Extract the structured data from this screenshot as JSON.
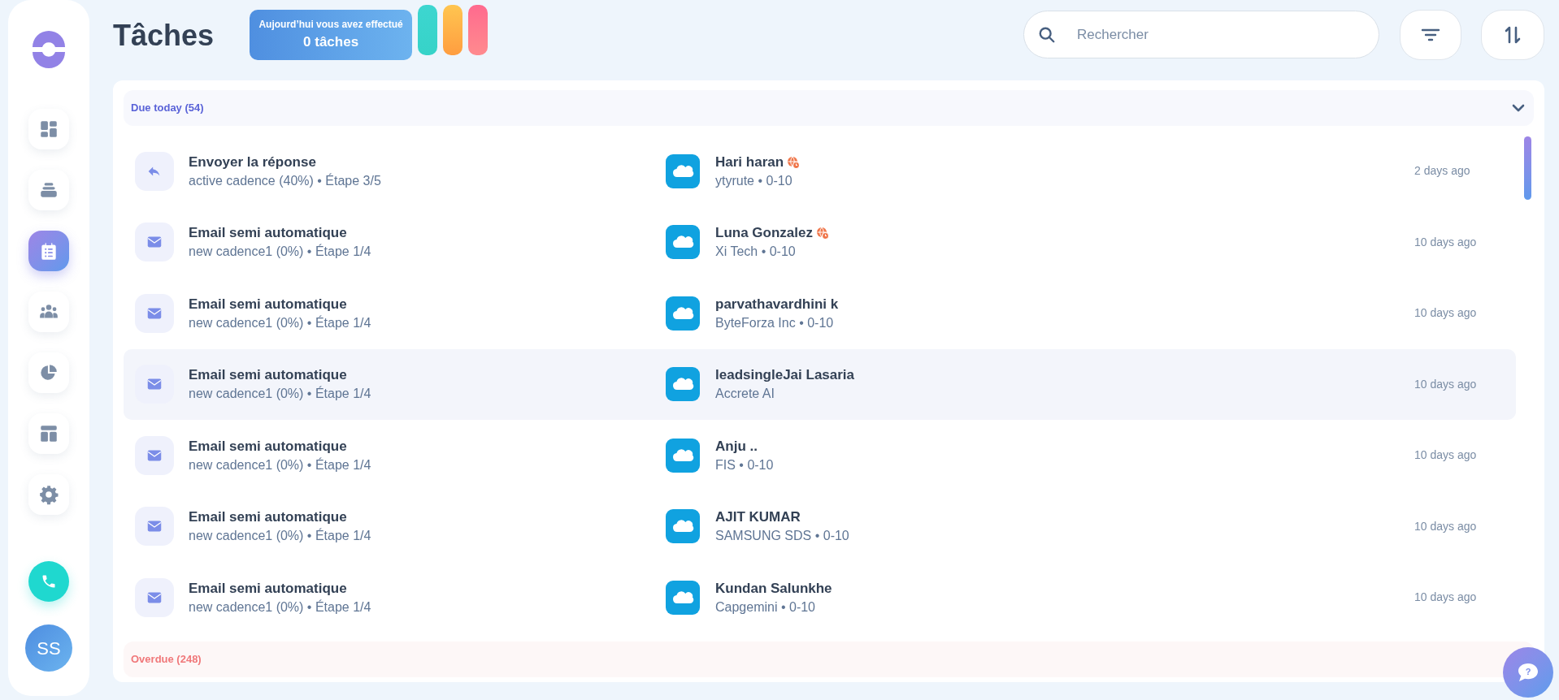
{
  "page": {
    "title": "Tâches"
  },
  "summary": {
    "caption": "Aujourd’hui vous avez effectué",
    "count": "0 tâches"
  },
  "sidebar": {
    "items": [
      {
        "kind": "dashboard",
        "selected": false
      },
      {
        "kind": "inbox",
        "selected": false
      },
      {
        "kind": "tasks",
        "selected": true
      },
      {
        "kind": "people",
        "selected": false
      },
      {
        "kind": "chart",
        "selected": false
      },
      {
        "kind": "layout",
        "selected": false
      },
      {
        "kind": "settings",
        "selected": false
      }
    ],
    "avatar": "SS"
  },
  "search": {
    "placeholder": "Rechercher"
  },
  "groups": [
    {
      "kind": "today",
      "label": "Due today (54)",
      "expanded": true,
      "rows": [
        {
          "kind": "reply",
          "title": "Envoyer la réponse",
          "subtitle": "active cadence (40%) • Étape 3/5",
          "contact": "Hari haran",
          "timezone_alert": true,
          "company": "ytyrute • 0-10",
          "time": "2 days ago",
          "selected": false
        },
        {
          "kind": "email",
          "title": "Email semi automatique",
          "subtitle": "new cadence1 (0%) • Étape 1/4",
          "contact": "Luna Gonzalez",
          "timezone_alert": true,
          "company": "Xi Tech • 0-10",
          "time": "10 days ago",
          "selected": false
        },
        {
          "kind": "email",
          "title": "Email semi automatique",
          "subtitle": "new cadence1 (0%) • Étape 1/4",
          "contact": "parvathavardhini k",
          "timezone_alert": false,
          "company": "ByteForza Inc • 0-10",
          "time": "10 days ago",
          "selected": false
        },
        {
          "kind": "email",
          "title": "Email semi automatique",
          "subtitle": "new cadence1 (0%) • Étape 1/4",
          "contact": "leadsingleJai Lasaria",
          "timezone_alert": false,
          "company": "Accrete AI",
          "time": "10 days ago",
          "selected": true
        },
        {
          "kind": "email",
          "title": "Email semi automatique",
          "subtitle": "new cadence1 (0%) • Étape 1/4",
          "contact": "Anju ..",
          "timezone_alert": false,
          "company": "FIS • 0-10",
          "time": "10 days ago",
          "selected": false
        },
        {
          "kind": "email",
          "title": "Email semi automatique",
          "subtitle": "new cadence1 (0%) • Étape 1/4",
          "contact": "AJIT KUMAR",
          "timezone_alert": false,
          "company": "SAMSUNG SDS • 0-10",
          "time": "10 days ago",
          "selected": false
        },
        {
          "kind": "email",
          "title": "Email semi automatique",
          "subtitle": "new cadence1 (0%) • Étape 1/4",
          "contact": "Kundan Salunkhe",
          "timezone_alert": false,
          "company": "Capgemini • 0-10",
          "time": "10 days ago",
          "selected": false
        }
      ]
    },
    {
      "kind": "overdue",
      "label": "Overdue (248)",
      "expanded": false
    }
  ],
  "help": {
    "glyph": "?"
  }
}
